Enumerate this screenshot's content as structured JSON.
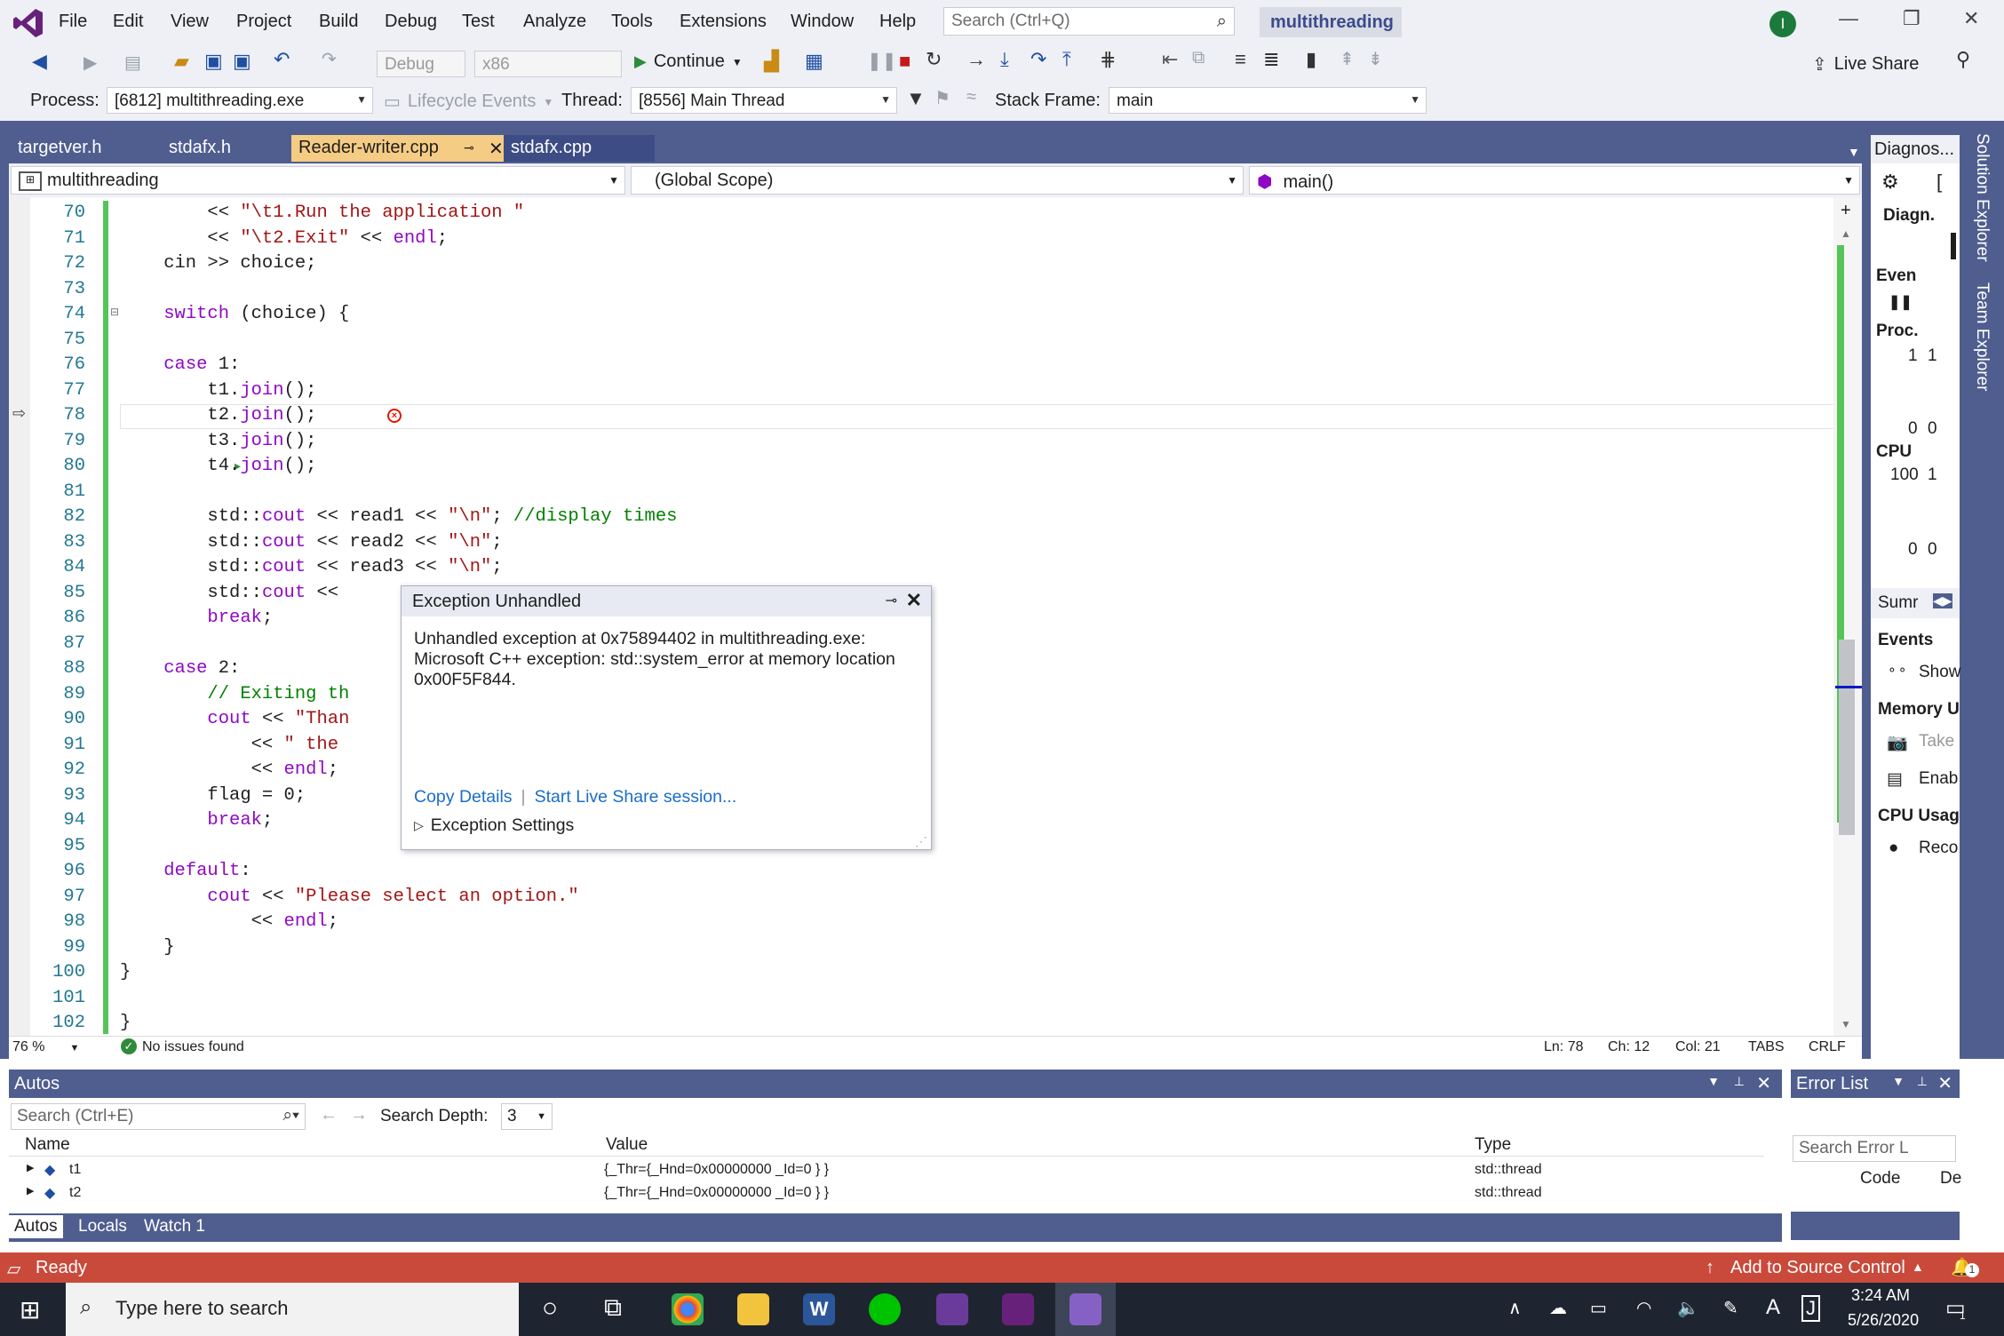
{
  "titlebar": {
    "menus": [
      "File",
      "Edit",
      "View",
      "Project",
      "Build",
      "Debug",
      "Test",
      "Analyze",
      "Tools",
      "Extensions",
      "Window",
      "Help"
    ],
    "search_placeholder": "Search (Ctrl+Q)",
    "solution": "multithreading",
    "avatar": "I"
  },
  "toolbar1": {
    "config": "Debug",
    "platform": "x86",
    "continue": "Continue",
    "live_share": "Live Share"
  },
  "toolbar2": {
    "process_label": "Process:",
    "process_value": "[6812] multithreading.exe",
    "lifecycle": "Lifecycle Events",
    "thread_label": "Thread:",
    "thread_value": "[8556] Main Thread",
    "stack_label": "Stack Frame:",
    "stack_value": "main"
  },
  "tabs": [
    "targetver.h",
    "stdafx.h",
    "Reader-writer.cpp",
    "stdafx.cpp"
  ],
  "navbar": {
    "project": "multithreading",
    "scope": "(Global Scope)",
    "member": "main()"
  },
  "editor": {
    "line_numbers": [
      "70",
      "71",
      "72",
      "73",
      "74",
      "75",
      "76",
      "77",
      "78",
      "79",
      "80",
      "81",
      "82",
      "83",
      "84",
      "85",
      "86",
      "87",
      "88",
      "89",
      "90",
      "91",
      "92",
      "93",
      "94",
      "95",
      "96",
      "97",
      "98",
      "99",
      "100",
      "101",
      "102"
    ],
    "lines": [
      "        << \"\\t1.Run the application \"",
      "        << \"\\t2.Exit\" << endl;",
      "    cin >> choice;",
      "",
      "    switch (choice) {",
      "",
      "    case 1:",
      "        t1.join();",
      "        t2.join();",
      "        t3.join();",
      "        t4.join();",
      "",
      "        std::cout << read1 << \"\\n\"; //display times",
      "        std::cout << read2 << \"\\n\";",
      "        std::cout << read3 << \"\\n\";",
      "        std::cout << ",
      "        break;",
      "",
      "    case 2:",
      "        // Exiting th",
      "        cout << \"Than",
      "            << \" the",
      "            << endl;",
      "        flag = 0;",
      "        break;",
      "",
      "    default:",
      "        cout << \"Please select an option.\"",
      "            << endl;",
      "    }",
      "}",
      "",
      "}"
    ]
  },
  "exception": {
    "title": "Exception Unhandled",
    "message": "Unhandled exception at 0x75894402 in multithreading.exe: Microsoft C++ exception: std::system_error at memory location 0x00F5F844.",
    "copy": "Copy Details",
    "live": "Start Live Share session...",
    "settings": "Exception Settings"
  },
  "editor_status": {
    "zoom": "76 %",
    "issues": "No issues found",
    "ln": "Ln: 78",
    "ch": "Ch: 12",
    "col": "Col: 21",
    "tabs": "TABS",
    "eol": "CRLF"
  },
  "diag": {
    "tab": "Diagnos...",
    "diagn": "Diagn.",
    "events": "Even",
    "process": "Proc.",
    "p1": "1",
    "p1b": "1",
    "p0": "0",
    "p0b": "0",
    "cpu": "CPU",
    "c100": "100",
    "c1": "1",
    "c0": "0",
    "c0b": "0",
    "summ": "Sumr",
    "events2": "Events",
    "show": "Show",
    "memory": "Memory U",
    "take": "Take",
    "enab": "Enab",
    "cpuusage": "CPU Usag",
    "reco": "Reco"
  },
  "side_tabs": [
    "Solution Explorer",
    "Team Explorer"
  ],
  "autos": {
    "title": "Autos",
    "search": "Search (Ctrl+E)",
    "depth_label": "Search Depth:",
    "depth": "3",
    "cols": [
      "Name",
      "Value",
      "Type"
    ],
    "rows": [
      {
        "name": "t1",
        "value": "{_Thr={_Hnd=0x00000000 _Id=0 } }",
        "type": "std::thread"
      },
      {
        "name": "t2",
        "value": "{_Thr={_Hnd=0x00000000 _Id=0 } }",
        "type": "std::thread"
      }
    ],
    "tabs": [
      "Autos",
      "Locals",
      "Watch 1"
    ]
  },
  "errorlist": {
    "title": "Error List",
    "search": "Search Error L",
    "code": "Code",
    "de": "De"
  },
  "status": {
    "ready": "Ready",
    "source": "Add to Source Control",
    "notif": "1"
  },
  "taskbar": {
    "search": "Type here to search",
    "time": "3:24 AM",
    "date": "5/26/2020",
    "notif": "1"
  }
}
